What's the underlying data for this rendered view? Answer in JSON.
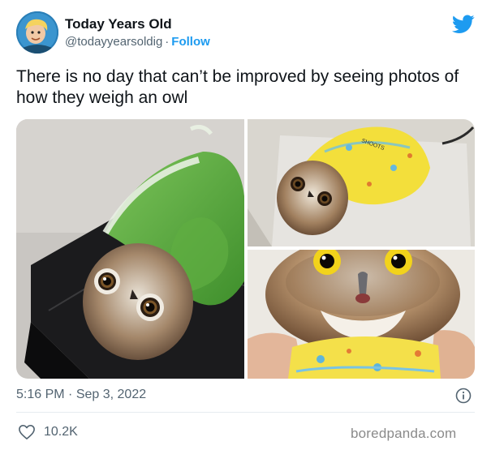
{
  "author": {
    "name": "Today Years Old",
    "handle": "@todayyearsoldig",
    "separator": "·",
    "follow_label": "Follow"
  },
  "tweet": {
    "text": "There is no day that can’t be improved by seeing photos of how they weigh an owl"
  },
  "media": {
    "photos": [
      {
        "subject": "owl wrapped in green towel on scale",
        "icon": "photo"
      },
      {
        "subject": "owl wrapped in yellow cloth on scale",
        "icon": "photo"
      },
      {
        "subject": "owl close-up in yellow wrap held by hand",
        "icon": "photo"
      }
    ]
  },
  "meta": {
    "time": "5:16 PM",
    "separator": "·",
    "date": "Sep 3, 2022",
    "likes": "10.2K"
  },
  "watermark": "boredpanda.com",
  "colors": {
    "accent": "#1d9bf0",
    "text": "#0f1419",
    "secondary": "#536471"
  },
  "icons": {
    "brand": "twitter-bird-icon",
    "info": "info-icon",
    "like": "heart-icon"
  }
}
